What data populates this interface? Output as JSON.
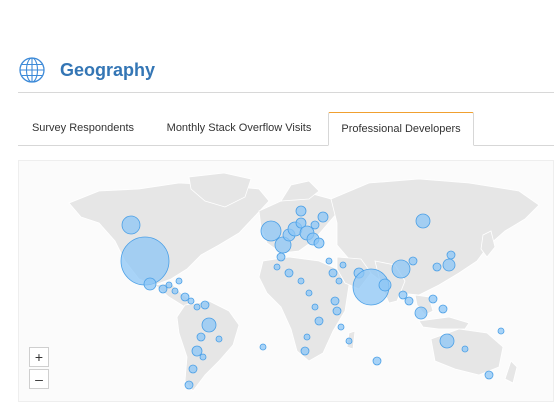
{
  "section": {
    "title": "Geography",
    "icon": "globe-icon"
  },
  "tabs": [
    {
      "label": "Survey Respondents",
      "active": false
    },
    {
      "label": "Monthly Stack Overflow Visits",
      "active": false
    },
    {
      "label": "Professional Developers",
      "active": true
    }
  ],
  "map": {
    "zoom_in_label": "+",
    "zoom_out_label": "–",
    "land_color": "#e6e6e6",
    "bubble_color": "#8cc6f5",
    "bubble_stroke": "#4a9fe6"
  }
}
